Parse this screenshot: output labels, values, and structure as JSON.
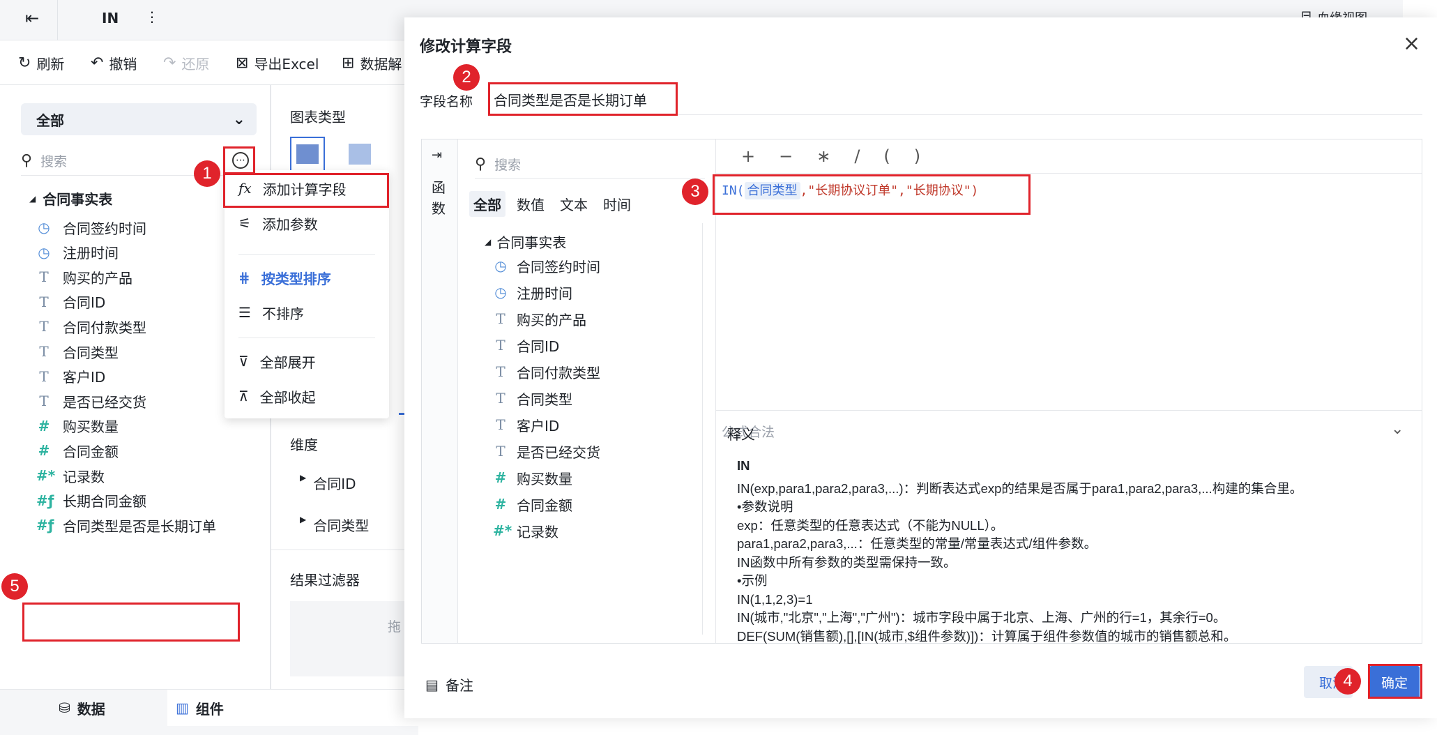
{
  "topbar": {
    "title": "IN",
    "right_label": "血缘视图"
  },
  "toolbar": {
    "refresh": "刷新",
    "undo": "撤销",
    "redo": "还原",
    "export": "导出Excel",
    "dataset": "数据解"
  },
  "left": {
    "select_value": "全部",
    "search_placeholder": "搜索",
    "table_name": "合同事实表",
    "fields": [
      {
        "name": "合同签约时间",
        "icon": "clock-icon"
      },
      {
        "name": "注册时间",
        "icon": "clock-icon"
      },
      {
        "name": "购买的产品",
        "icon": "text-icon"
      },
      {
        "name": "合同ID",
        "icon": "text-icon"
      },
      {
        "name": "合同付款类型",
        "icon": "text-icon"
      },
      {
        "name": "合同类型",
        "icon": "text-icon"
      },
      {
        "name": "客户ID",
        "icon": "text-icon"
      },
      {
        "name": "是否已经交货",
        "icon": "text-icon"
      },
      {
        "name": "购买数量",
        "icon": "number-icon"
      },
      {
        "name": "合同金额",
        "icon": "number-icon"
      },
      {
        "name": "记录数",
        "icon": "count-icon"
      },
      {
        "name": "长期合同金额",
        "icon": "calc-number-icon"
      },
      {
        "name": "合同类型是否是长期订单",
        "icon": "calc-number-icon"
      }
    ]
  },
  "menu": {
    "add_calc_field": "添加计算字段",
    "add_param": "添加参数",
    "sort_by_type": "按类型排序",
    "no_sort": "不排序",
    "expand_all": "全部展开",
    "collapse_all": "全部收起"
  },
  "mid": {
    "chart_type": "图表类型",
    "dimension": "维度",
    "dim_items": [
      "合同ID",
      "合同类型"
    ],
    "result_filter": "结果过滤器",
    "drag_hint": "拖"
  },
  "bottom_tabs": {
    "data": "数据",
    "component": "组件"
  },
  "modal": {
    "title": "修改计算字段",
    "field_name_label": "字段名称",
    "field_name_value": "合同类型是否是长期订单",
    "func_tab_label": "函数",
    "search_placeholder": "搜索",
    "filter_tabs": [
      "全部",
      "数值",
      "文本",
      "时间"
    ],
    "table_name": "合同事实表",
    "fields": [
      {
        "name": "合同签约时间",
        "icon": "clock-icon"
      },
      {
        "name": "注册时间",
        "icon": "clock-icon"
      },
      {
        "name": "购买的产品",
        "icon": "text-icon"
      },
      {
        "name": "合同ID",
        "icon": "text-icon"
      },
      {
        "name": "合同付款类型",
        "icon": "text-icon"
      },
      {
        "name": "合同类型",
        "icon": "text-icon"
      },
      {
        "name": "客户ID",
        "icon": "text-icon"
      },
      {
        "name": "是否已经交货",
        "icon": "text-icon"
      },
      {
        "name": "购买数量",
        "icon": "number-icon"
      },
      {
        "name": "合同金额",
        "icon": "number-icon"
      },
      {
        "name": "记录数",
        "icon": "count-icon"
      }
    ],
    "operators": [
      "+",
      "−",
      "∗",
      "/",
      "(",
      ")"
    ],
    "formula": {
      "func": "IN(",
      "field": "合同类型",
      "args": ",\"长期协议订单\",\"长期协议\")"
    },
    "formula_status": "公式合法",
    "definition_title": "释义",
    "definition": [
      "IN",
      "IN(exp,para1,para2,para3,...)：判断表达式exp的结果是否属于para1,para2,para3,...构建的集合里。",
      "•参数说明",
      "exp：任意类型的任意表达式（不能为NULL）。",
      "para1,para2,para3,...：任意类型的常量/常量表达式/组件参数。",
      "IN函数中所有参数的类型需保持一致。",
      "•示例",
      "IN(1,1,2,3)=1",
      "IN(城市,\"北京\",\"上海\",\"广州\")：城市字段中属于北京、上海、广州的行=1，其余行=0。",
      "DEF(SUM(销售额),[],[IN(城市,$组件参数)])：计算属于组件参数值的城市的销售额总和。"
    ],
    "note": "备注",
    "cancel": "取消",
    "ok": "确定"
  },
  "annotations": [
    "1",
    "2",
    "3",
    "4",
    "5"
  ],
  "colors": {
    "accent": "#3a6fd8",
    "annotation": "#e0232b",
    "number_icon": "#2db3a0"
  }
}
